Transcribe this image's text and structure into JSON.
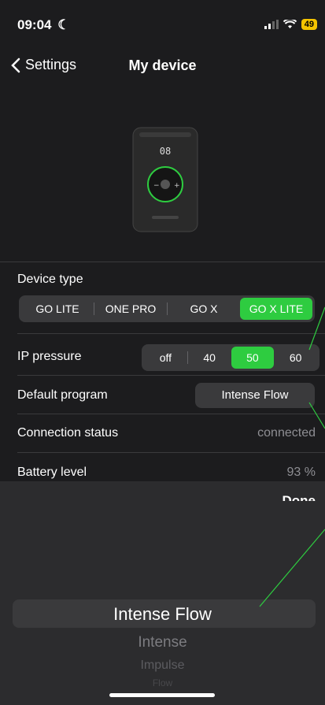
{
  "status": {
    "time": "09:04",
    "battery": "49"
  },
  "nav": {
    "back_label": "Settings",
    "title": "My device"
  },
  "device_type": {
    "label": "Device type",
    "options": [
      "GO LITE",
      "ONE PRO",
      "GO X",
      "GO X LITE"
    ],
    "selected": "GO X LITE"
  },
  "ip_pressure": {
    "label": "IP pressure",
    "options": [
      "off",
      "40",
      "50",
      "60"
    ],
    "selected": "50"
  },
  "default_program": {
    "label": "Default program",
    "value": "Intense Flow"
  },
  "connection": {
    "label": "Connection status",
    "value": "connected"
  },
  "battery": {
    "label": "Battery level",
    "value": "93 %"
  },
  "picker": {
    "done_label": "Done",
    "items": [
      "Intense Flow",
      "Intense",
      "Impulse",
      "Flow"
    ],
    "selected": "Intense Flow"
  },
  "colors": {
    "accent_green": "#2ecc40",
    "background": "#1c1c1e"
  }
}
